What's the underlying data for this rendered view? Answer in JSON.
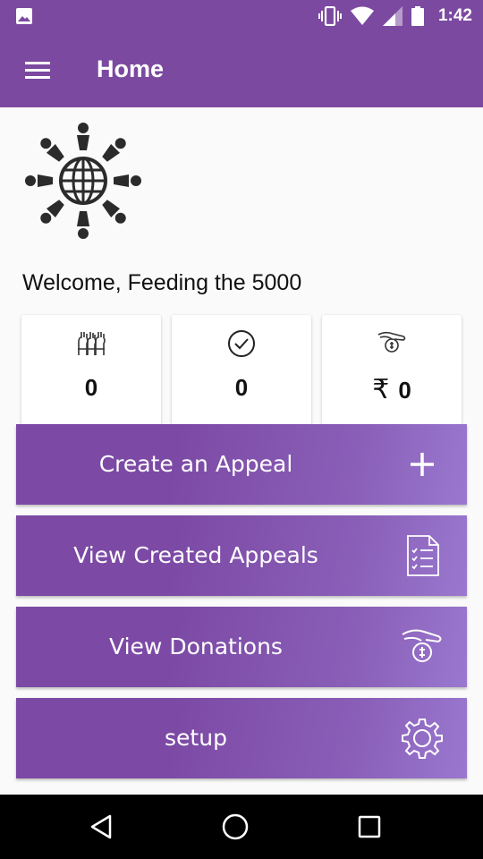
{
  "status_bar": {
    "time": "1:42",
    "icons": [
      "image-notification-icon",
      "vibrate-icon",
      "wifi-icon",
      "signal-icon",
      "battery-icon"
    ]
  },
  "app_bar": {
    "title": "Home",
    "menu_icon": "hamburger-menu-icon"
  },
  "logo": {
    "icon": "people-around-globe-logo"
  },
  "welcome_text": "Welcome, Feeding the 5000",
  "stats": [
    {
      "icon": "raised-hands-icon",
      "value": "0",
      "currency": ""
    },
    {
      "icon": "check-circle-icon",
      "value": "0",
      "currency": ""
    },
    {
      "icon": "hand-donation-icon",
      "value": "0",
      "currency": "₹"
    }
  ],
  "actions": [
    {
      "label": "Create an Appeal",
      "icon": "plus-icon"
    },
    {
      "label": "View Created Appeals",
      "icon": "document-list-icon"
    },
    {
      "label": "View Donations",
      "icon": "hand-donation-icon"
    },
    {
      "label": "setup",
      "icon": "gear-icon"
    }
  ],
  "nav_bar": {
    "icons": [
      "back-triangle-icon",
      "home-circle-icon",
      "recents-square-icon"
    ]
  },
  "colors": {
    "primary": "#7b4aa0",
    "button_gradient_end": "#9a78cf",
    "nav_bar": "#000000"
  }
}
